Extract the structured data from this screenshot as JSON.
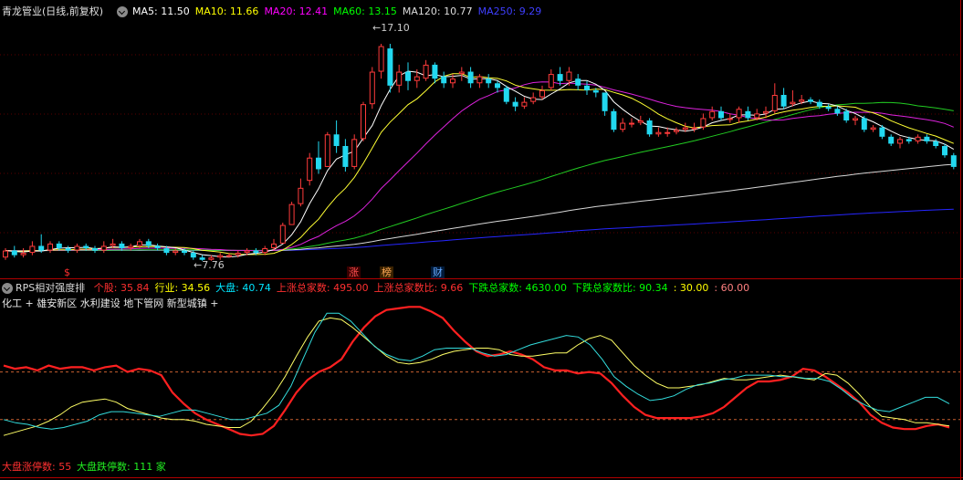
{
  "top_panel": {
    "title": "青龙管业(日线,前复权)",
    "ma_items": [
      {
        "text": "MA5: 11.50",
        "color": "#ffffff"
      },
      {
        "text": "MA10: 11.66",
        "color": "#ffff00"
      },
      {
        "text": "MA20: 12.41",
        "color": "#ff00ff"
      },
      {
        "text": "MA60: 13.15",
        "color": "#00ff00"
      },
      {
        "text": "MA120: 10.77",
        "color": "#dddddd"
      },
      {
        "text": "MA250: 9.29",
        "color": "#3f3fff"
      }
    ],
    "high_label": "17.10",
    "low_label": "7.76",
    "marker_s": "$",
    "tag_zhang": "涨",
    "tag_bang": "榜",
    "tag_cai": "财"
  },
  "bottom_panel": {
    "indicator_title": "RPS相对强度排",
    "stats": [
      {
        "text": "个股: 35.84",
        "color": "#ff3030"
      },
      {
        "text": "行业: 34.56",
        "color": "#ffff00"
      },
      {
        "text": "大盘: 40.74",
        "color": "#00e5ff"
      },
      {
        "text": "上涨总家数: 495.00",
        "color": "#ff3030"
      },
      {
        "text": "上涨总家数比: 9.66",
        "color": "#ff3030"
      },
      {
        "text": "下跌总家数: 4630.00",
        "color": "#00ff00"
      },
      {
        "text": "下跌总家数比: 90.34",
        "color": "#00ff00"
      },
      {
        "text": ": 30.00",
        "color": "#ffff00"
      },
      {
        "text": ": 60.00",
        "color": "#ff8080"
      }
    ],
    "sector_line": "化工 + 雄安新区 水利建设 地下管网 新型城镇 +",
    "footer_up": "大盘涨停数: 55",
    "footer_down": "大盘跌停数: 111 家"
  },
  "chart_data": [
    {
      "type": "candlestick",
      "title": "青龙管业(日线,前复权)",
      "candles": [
        {
          "o": 7.9,
          "c": 8.2,
          "h": 8.3,
          "l": 7.8
        },
        {
          "o": 8.2,
          "c": 8.0,
          "h": 8.4,
          "l": 7.9
        },
        {
          "o": 8.0,
          "c": 8.1,
          "h": 8.3,
          "l": 7.9
        },
        {
          "o": 8.1,
          "c": 8.4,
          "h": 8.6,
          "l": 8.0
        },
        {
          "o": 8.4,
          "c": 8.2,
          "h": 8.9,
          "l": 8.1
        },
        {
          "o": 8.2,
          "c": 8.5,
          "h": 8.6,
          "l": 8.1
        },
        {
          "o": 8.5,
          "c": 8.3,
          "h": 8.6,
          "l": 8.2
        },
        {
          "o": 8.3,
          "c": 8.2,
          "h": 8.4,
          "l": 8.1
        },
        {
          "o": 8.2,
          "c": 8.4,
          "h": 8.5,
          "l": 8.1
        },
        {
          "o": 8.4,
          "c": 8.3,
          "h": 8.5,
          "l": 8.2
        },
        {
          "o": 8.3,
          "c": 8.2,
          "h": 8.4,
          "l": 8.1
        },
        {
          "o": 8.2,
          "c": 8.4,
          "h": 8.6,
          "l": 8.1
        },
        {
          "o": 8.4,
          "c": 8.5,
          "h": 8.7,
          "l": 8.3
        },
        {
          "o": 8.5,
          "c": 8.3,
          "h": 8.6,
          "l": 8.2
        },
        {
          "o": 8.3,
          "c": 8.4,
          "h": 8.5,
          "l": 8.2
        },
        {
          "o": 8.4,
          "c": 8.6,
          "h": 8.7,
          "l": 8.3
        },
        {
          "o": 8.6,
          "c": 8.4,
          "h": 8.7,
          "l": 8.3
        },
        {
          "o": 8.4,
          "c": 8.3,
          "h": 8.5,
          "l": 8.2
        },
        {
          "o": 8.3,
          "c": 8.1,
          "h": 8.4,
          "l": 8.0
        },
        {
          "o": 8.1,
          "c": 8.2,
          "h": 8.3,
          "l": 8.0
        },
        {
          "o": 8.2,
          "c": 8.1,
          "h": 8.3,
          "l": 8.0
        },
        {
          "o": 8.1,
          "c": 7.9,
          "h": 8.2,
          "l": 7.8
        },
        {
          "o": 7.9,
          "c": 7.8,
          "h": 8.0,
          "l": 7.76
        },
        {
          "o": 7.8,
          "c": 7.9,
          "h": 8.0,
          "l": 7.76
        },
        {
          "o": 7.9,
          "c": 8.0,
          "h": 8.1,
          "l": 7.8
        },
        {
          "o": 8.0,
          "c": 8.0,
          "h": 8.1,
          "l": 7.9
        },
        {
          "o": 8.0,
          "c": 8.1,
          "h": 8.2,
          "l": 7.9
        },
        {
          "o": 8.1,
          "c": 8.2,
          "h": 8.3,
          "l": 8.0
        },
        {
          "o": 8.2,
          "c": 8.1,
          "h": 8.3,
          "l": 8.0
        },
        {
          "o": 8.1,
          "c": 8.3,
          "h": 8.4,
          "l": 8.0
        },
        {
          "o": 8.3,
          "c": 8.5,
          "h": 8.7,
          "l": 8.2
        },
        {
          "o": 8.5,
          "c": 9.3,
          "h": 9.4,
          "l": 8.5
        },
        {
          "o": 9.3,
          "c": 10.2,
          "h": 10.3,
          "l": 9.3
        },
        {
          "o": 10.2,
          "c": 10.9,
          "h": 11.3,
          "l": 10.1
        },
        {
          "o": 11.2,
          "c": 12.2,
          "h": 12.4,
          "l": 11.0
        },
        {
          "o": 12.2,
          "c": 11.7,
          "h": 12.9,
          "l": 11.5
        },
        {
          "o": 11.8,
          "c": 13.2,
          "h": 13.3,
          "l": 11.8
        },
        {
          "o": 13.2,
          "c": 12.7,
          "h": 13.8,
          "l": 12.4
        },
        {
          "o": 12.7,
          "c": 11.8,
          "h": 13.0,
          "l": 11.6
        },
        {
          "o": 11.8,
          "c": 13.0,
          "h": 13.2,
          "l": 11.7
        },
        {
          "o": 13.0,
          "c": 14.5,
          "h": 14.6,
          "l": 12.9
        },
        {
          "o": 14.5,
          "c": 15.9,
          "h": 16.1,
          "l": 14.3
        },
        {
          "o": 15.9,
          "c": 17.0,
          "h": 17.1,
          "l": 15.6
        },
        {
          "o": 16.9,
          "c": 15.3,
          "h": 17.1,
          "l": 15.0
        },
        {
          "o": 15.3,
          "c": 15.9,
          "h": 16.2,
          "l": 15.0
        },
        {
          "o": 15.9,
          "c": 15.5,
          "h": 16.3,
          "l": 15.1
        },
        {
          "o": 15.5,
          "c": 15.7,
          "h": 16.0,
          "l": 15.2
        },
        {
          "o": 15.6,
          "c": 16.2,
          "h": 16.4,
          "l": 15.5
        },
        {
          "o": 16.2,
          "c": 15.6,
          "h": 16.3,
          "l": 15.4
        },
        {
          "o": 15.7,
          "c": 15.4,
          "h": 15.9,
          "l": 15.2
        },
        {
          "o": 15.4,
          "c": 15.6,
          "h": 15.8,
          "l": 15.2
        },
        {
          "o": 15.8,
          "c": 15.9,
          "h": 16.1,
          "l": 15.5
        },
        {
          "o": 15.9,
          "c": 15.4,
          "h": 16.1,
          "l": 15.2
        },
        {
          "o": 15.4,
          "c": 15.7,
          "h": 15.8,
          "l": 15.2
        },
        {
          "o": 15.6,
          "c": 15.4,
          "h": 15.8,
          "l": 15.2
        },
        {
          "o": 15.4,
          "c": 15.2,
          "h": 15.5,
          "l": 15.0
        },
        {
          "o": 15.2,
          "c": 14.6,
          "h": 15.3,
          "l": 14.5
        },
        {
          "o": 14.6,
          "c": 14.4,
          "h": 14.8,
          "l": 14.2
        },
        {
          "o": 14.4,
          "c": 14.6,
          "h": 14.8,
          "l": 14.3
        },
        {
          "o": 14.6,
          "c": 14.8,
          "h": 15.0,
          "l": 14.5
        },
        {
          "o": 14.8,
          "c": 15.1,
          "h": 15.3,
          "l": 14.7
        },
        {
          "o": 15.2,
          "c": 15.8,
          "h": 16.0,
          "l": 15.1
        },
        {
          "o": 15.8,
          "c": 15.5,
          "h": 16.1,
          "l": 15.3
        },
        {
          "o": 15.5,
          "c": 15.9,
          "h": 16.1,
          "l": 15.3
        },
        {
          "o": 15.6,
          "c": 15.3,
          "h": 15.8,
          "l": 15.1
        },
        {
          "o": 15.3,
          "c": 15.1,
          "h": 15.5,
          "l": 14.9
        },
        {
          "o": 15.1,
          "c": 15.0,
          "h": 15.2,
          "l": 14.8
        },
        {
          "o": 15.0,
          "c": 14.2,
          "h": 15.0,
          "l": 14.0
        },
        {
          "o": 14.2,
          "c": 13.4,
          "h": 14.3,
          "l": 13.3
        },
        {
          "o": 13.4,
          "c": 13.7,
          "h": 13.9,
          "l": 13.3
        },
        {
          "o": 13.7,
          "c": 13.7,
          "h": 13.9,
          "l": 13.5
        },
        {
          "o": 13.7,
          "c": 13.8,
          "h": 14.0,
          "l": 13.6
        },
        {
          "o": 13.8,
          "c": 13.2,
          "h": 13.9,
          "l": 13.1
        },
        {
          "o": 13.2,
          "c": 13.3,
          "h": 13.5,
          "l": 13.1
        },
        {
          "o": 13.3,
          "c": 13.3,
          "h": 13.5,
          "l": 13.1
        },
        {
          "o": 13.3,
          "c": 13.4,
          "h": 13.5,
          "l": 13.2
        },
        {
          "o": 13.4,
          "c": 13.5,
          "h": 13.7,
          "l": 13.3
        },
        {
          "o": 13.5,
          "c": 13.5,
          "h": 13.7,
          "l": 13.3
        },
        {
          "o": 13.5,
          "c": 13.9,
          "h": 14.1,
          "l": 13.4
        },
        {
          "o": 13.9,
          "c": 14.2,
          "h": 14.4,
          "l": 13.8
        },
        {
          "o": 14.2,
          "c": 13.9,
          "h": 14.4,
          "l": 13.8
        },
        {
          "o": 13.9,
          "c": 13.9,
          "h": 14.1,
          "l": 13.7
        },
        {
          "o": 13.9,
          "c": 14.3,
          "h": 14.4,
          "l": 13.7
        },
        {
          "o": 14.2,
          "c": 13.9,
          "h": 14.4,
          "l": 13.8
        },
        {
          "o": 13.9,
          "c": 14.1,
          "h": 14.3,
          "l": 13.8
        },
        {
          "o": 14.1,
          "c": 14.2,
          "h": 14.4,
          "l": 13.9
        },
        {
          "o": 14.2,
          "c": 14.9,
          "h": 15.4,
          "l": 14.1
        },
        {
          "o": 14.9,
          "c": 14.4,
          "h": 15.2,
          "l": 14.3
        },
        {
          "o": 14.5,
          "c": 14.6,
          "h": 15.1,
          "l": 14.4
        },
        {
          "o": 14.6,
          "c": 14.7,
          "h": 14.9,
          "l": 14.5
        },
        {
          "o": 14.7,
          "c": 14.6,
          "h": 14.8,
          "l": 14.5
        },
        {
          "o": 14.6,
          "c": 14.4,
          "h": 14.7,
          "l": 14.3
        },
        {
          "o": 14.4,
          "c": 14.3,
          "h": 14.5,
          "l": 14.2
        },
        {
          "o": 14.3,
          "c": 14.1,
          "h": 14.4,
          "l": 14.0
        },
        {
          "o": 14.2,
          "c": 13.8,
          "h": 14.3,
          "l": 13.7
        },
        {
          "o": 13.8,
          "c": 13.9,
          "h": 14.0,
          "l": 13.6
        },
        {
          "o": 13.9,
          "c": 13.4,
          "h": 14.0,
          "l": 13.3
        },
        {
          "o": 13.4,
          "c": 13.5,
          "h": 13.6,
          "l": 13.3
        },
        {
          "o": 13.5,
          "c": 13.1,
          "h": 13.6,
          "l": 13.0
        },
        {
          "o": 13.1,
          "c": 12.8,
          "h": 13.2,
          "l": 12.7
        },
        {
          "o": 12.8,
          "c": 13.0,
          "h": 13.1,
          "l": 12.6
        },
        {
          "o": 13.0,
          "c": 12.9,
          "h": 13.1,
          "l": 12.8
        },
        {
          "o": 12.9,
          "c": 13.1,
          "h": 13.2,
          "l": 12.8
        },
        {
          "o": 13.1,
          "c": 12.9,
          "h": 13.2,
          "l": 12.8
        },
        {
          "o": 12.9,
          "c": 12.7,
          "h": 13.0,
          "l": 12.6
        },
        {
          "o": 12.7,
          "c": 12.3,
          "h": 12.8,
          "l": 12.2
        },
        {
          "o": 12.3,
          "c": 11.8,
          "h": 12.4,
          "l": 11.7
        }
      ],
      "ylim": [
        7.2,
        18.2
      ]
    },
    {
      "type": "line",
      "title": "RPS相对强度排",
      "ylim": [
        0,
        100
      ],
      "reference_levels": [
        30,
        60
      ],
      "series": [
        {
          "name": "个股",
          "color": "#ff2020",
          "values": [
            64,
            62,
            63,
            61,
            64,
            62,
            63,
            63,
            61,
            63,
            64,
            60,
            62,
            61,
            58,
            47,
            40,
            34,
            30,
            27,
            24,
            21,
            20,
            21,
            26,
            36,
            47,
            55,
            60,
            63,
            68,
            79,
            88,
            95,
            99,
            100,
            101,
            101,
            98,
            94,
            86,
            79,
            73,
            70,
            71,
            73,
            71,
            68,
            63,
            61,
            61,
            59,
            60,
            59,
            53,
            45,
            38,
            33,
            31,
            31,
            31,
            31,
            32,
            34,
            38,
            44,
            50,
            54,
            54,
            55,
            57,
            62,
            61,
            57,
            52,
            47,
            41,
            33,
            28,
            25,
            24,
            24,
            26,
            27,
            25
          ]
        },
        {
          "name": "行业",
          "color": "#ffff66",
          "values": [
            20,
            22,
            24,
            26,
            29,
            33,
            38,
            41,
            42,
            43,
            41,
            37,
            35,
            33,
            31,
            30,
            30,
            29,
            27,
            26,
            25,
            25,
            29,
            37,
            46,
            57,
            70,
            82,
            92,
            94,
            93,
            88,
            82,
            76,
            70,
            66,
            65,
            66,
            68,
            71,
            73,
            74,
            75,
            75,
            74,
            71,
            70,
            70,
            71,
            72,
            72,
            77,
            81,
            83,
            80,
            72,
            64,
            58,
            53,
            50,
            50,
            51,
            52,
            54,
            56,
            55,
            55,
            56,
            57,
            58,
            57,
            56,
            55,
            59,
            58,
            53,
            46,
            38,
            32,
            31,
            30,
            28,
            28,
            27,
            26
          ]
        },
        {
          "name": "大盘",
          "color": "#33dddd",
          "values": [
            30,
            28,
            27,
            25,
            24,
            25,
            27,
            29,
            33,
            35,
            35,
            34,
            33,
            32,
            34,
            36,
            36,
            34,
            32,
            30,
            30,
            32,
            34,
            39,
            51,
            68,
            85,
            97,
            97,
            92,
            84,
            76,
            71,
            68,
            67,
            70,
            74,
            75,
            75,
            75,
            72,
            70,
            71,
            74,
            77,
            79,
            81,
            83,
            82,
            77,
            68,
            57,
            51,
            46,
            42,
            43,
            45,
            49,
            52,
            53,
            55,
            56,
            58,
            58,
            58,
            57,
            57,
            56,
            56,
            54,
            49,
            43,
            39,
            36,
            35,
            38,
            41,
            44,
            44,
            40
          ]
        }
      ]
    }
  ]
}
